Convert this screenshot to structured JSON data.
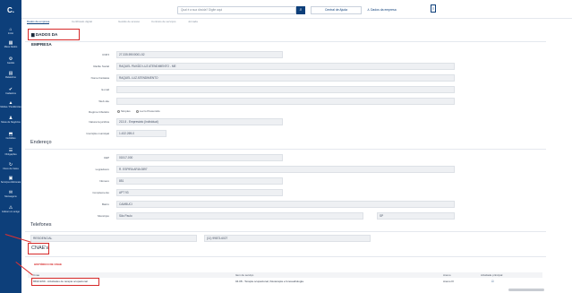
{
  "sidebar": {
    "logo": "C.",
    "items": [
      {
        "icon": "⌂",
        "label": "Início"
      },
      {
        "icon": "▦",
        "label": "Meus Dados"
      },
      {
        "icon": "⚙",
        "label": "Gestão"
      },
      {
        "icon": "▤",
        "label": "Relatórios"
      },
      {
        "icon": "✔",
        "label": "Cadastros"
      },
      {
        "icon": "▲",
        "label": "Multas / Pendências"
      },
      {
        "icon": "♟",
        "label": "Mesa de Negócios"
      },
      {
        "icon": "⬒",
        "label": "Certidões"
      },
      {
        "icon": "☰",
        "label": "Obrigações"
      },
      {
        "icon": "↻",
        "label": "Fluxo de Caixa"
      },
      {
        "icon": "▣",
        "label": "Serviços Adicionais"
      },
      {
        "icon": "✉",
        "label": "Mensagens"
      },
      {
        "icon": "⚠",
        "label": "Indicar um amigo"
      }
    ]
  },
  "topbar": {
    "search_placeholder": "Qual é a sua dúvida? Digite aqui",
    "help_label": "Central de Ajuda",
    "company_label": "Dados da empresa"
  },
  "tabs": [
    "Dados da empresa",
    "Certificado digital",
    "Gestão de acesso",
    "Contrato de serviços",
    "Jornada"
  ],
  "section_title": "DADOS DA EMPRESA",
  "company": {
    "cnpj_label": "CNPJ",
    "cnpj": "27.335.590/0001-52",
    "razao_label": "Razão Social",
    "razao": "RAQUEL PAIXÃO LUZ ATENDIMENTO - ME",
    "fantasia_label": "Nome Fantasia",
    "fantasia": "RAQUEL LUZ ATENDIMENTO",
    "email_label": "E-mail",
    "email": "",
    "site_label": "Web site",
    "site": "",
    "regime_label": "Regime tributário",
    "regime_opt1": "Simples",
    "regime_opt2": "Lucro Presumido",
    "natureza_label": "Natureza jurídica",
    "natureza": "213-5 - Empresário (Individual)",
    "inscricao_label": "Inscrição municipal",
    "inscricao": "1.432.269-0"
  },
  "address": {
    "title": "Endereço",
    "cep_label": "CEP",
    "cep": "01517-000",
    "logradouro_label": "Logradouro",
    "logradouro": "R. ESPIRA ARIA 0897",
    "numero_label": "Número",
    "numero": "851",
    "complemento_label": "Complemento",
    "complemento": "APT 93",
    "bairro_label": "Bairro",
    "bairro": "CAMBUCI",
    "municipio_label": "Município",
    "municipio": "São Paulo",
    "uf": "SP"
  },
  "phones": {
    "title": "Telefones",
    "type": "RESIDENCIAL",
    "number": "(11) 99873-6027"
  },
  "cnae": {
    "title": "CNAE's",
    "history_label": "HISTÓRICO DE CNAE",
    "columns": [
      "Cnae",
      "Item de serviço",
      "Anexo",
      "Atividade principal"
    ],
    "rows": [
      {
        "cnae": "8690-9/99 - Atividades de terapia ocupacional",
        "item": "04.08 - Terapia ocupacional, fisioterapia e fonoaudiologia.",
        "anexo": "Anexo III",
        "principal": "☑"
      }
    ]
  }
}
